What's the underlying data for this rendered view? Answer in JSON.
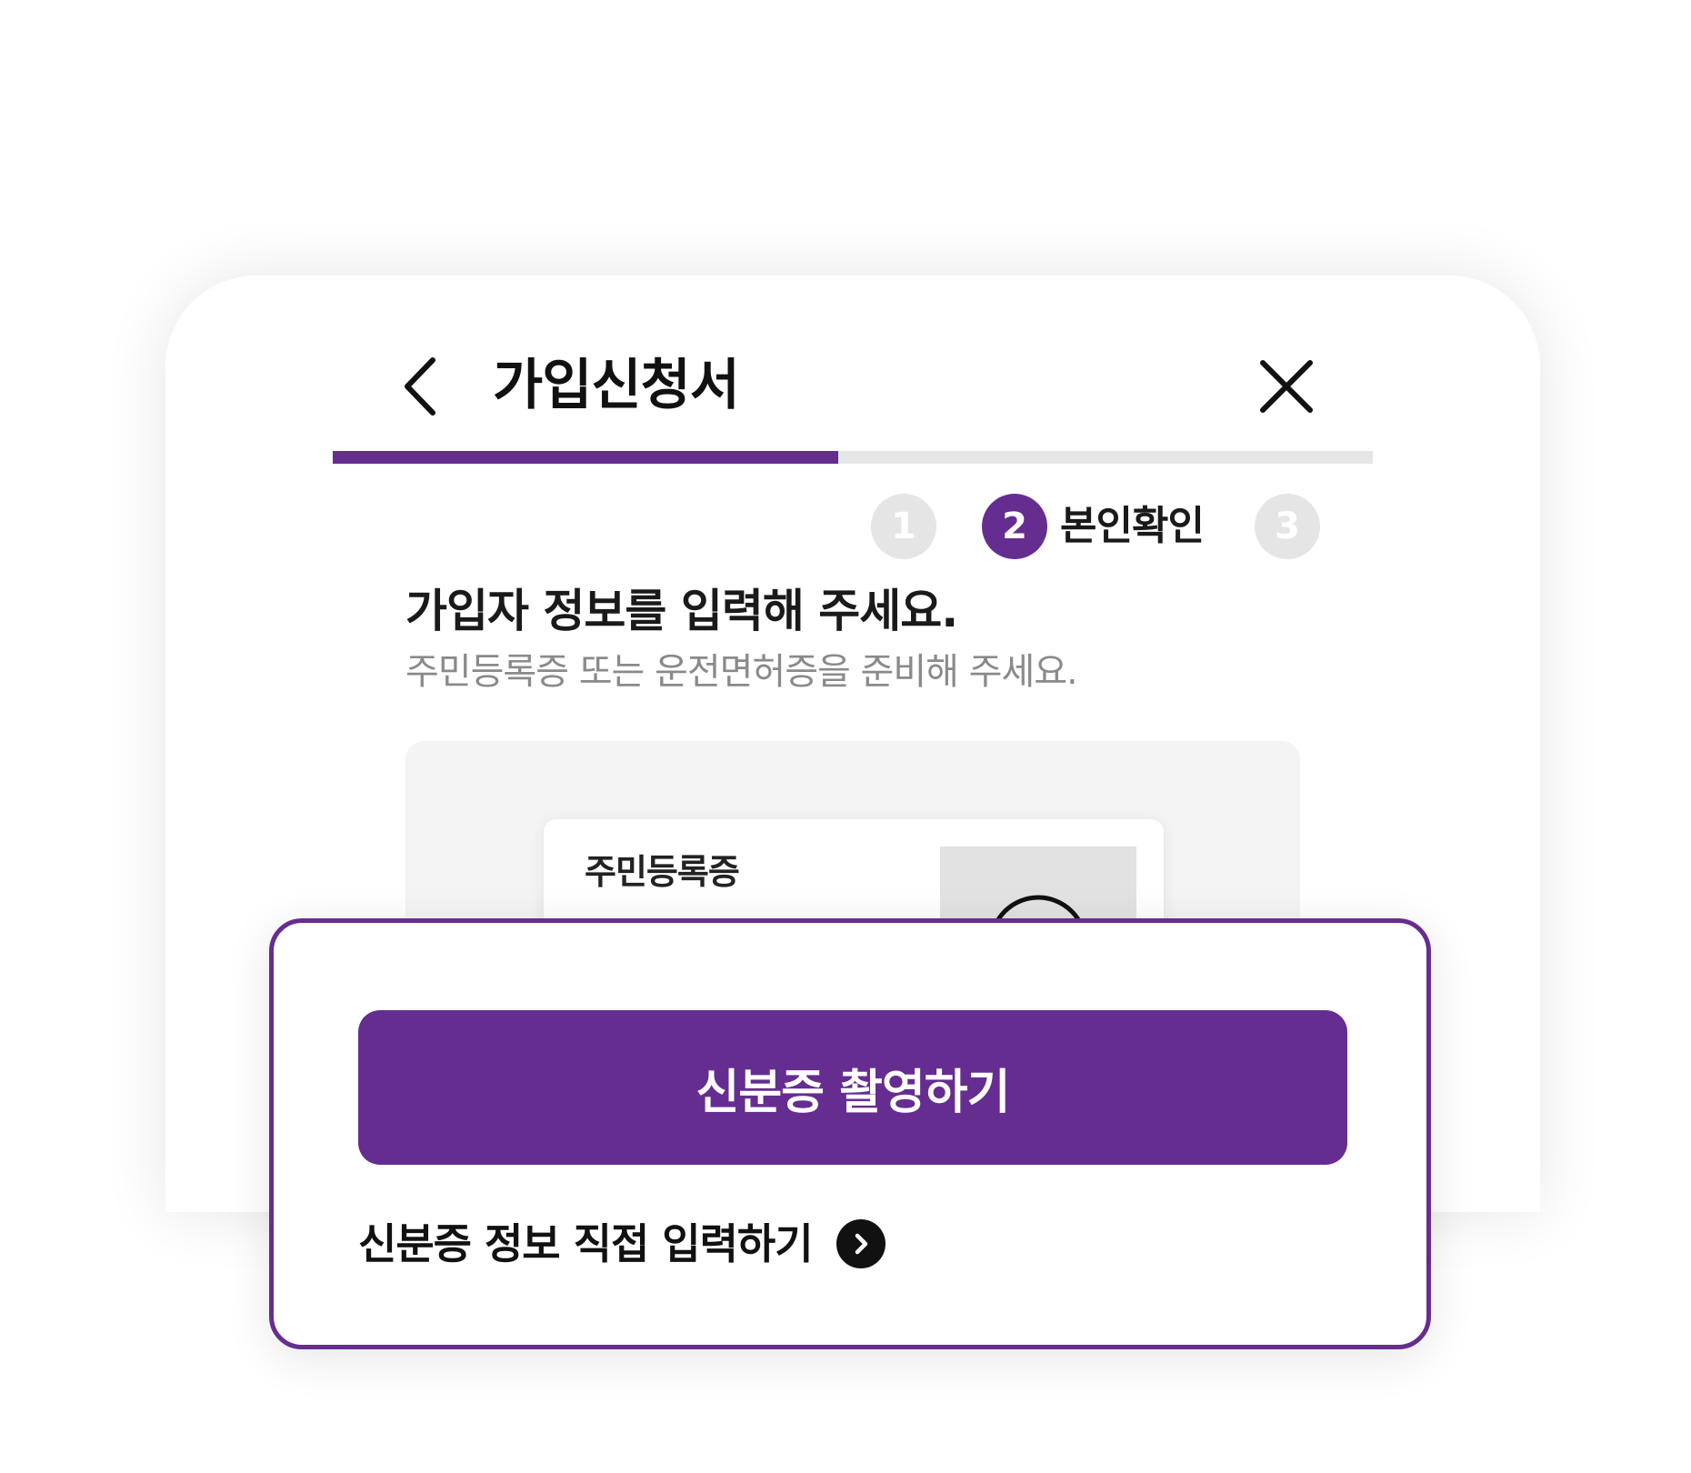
{
  "header": {
    "title": "가입신청서",
    "back_icon": "chevron-left-icon",
    "close_icon": "close-icon"
  },
  "progress": {
    "value": 0.486,
    "accent_color": "#662d91",
    "track_color": "#e6e6e6"
  },
  "steps": {
    "items": [
      {
        "number": "1",
        "state": "inactive"
      },
      {
        "number": "2",
        "state": "active",
        "label": "본인확인"
      },
      {
        "number": "3",
        "state": "inactive"
      }
    ]
  },
  "main": {
    "heading": "가입자 정보를 입력해 주세요.",
    "subheading": "주민등록증 또는 운전면허증을 준비해 주세요.",
    "id_card_title": "주민등록증"
  },
  "sheet": {
    "primary_button_label": "신분증 촬영하기",
    "link_label": "신분증 정보 직접 입력하기",
    "link_icon": "chevron-right-circle-icon"
  }
}
